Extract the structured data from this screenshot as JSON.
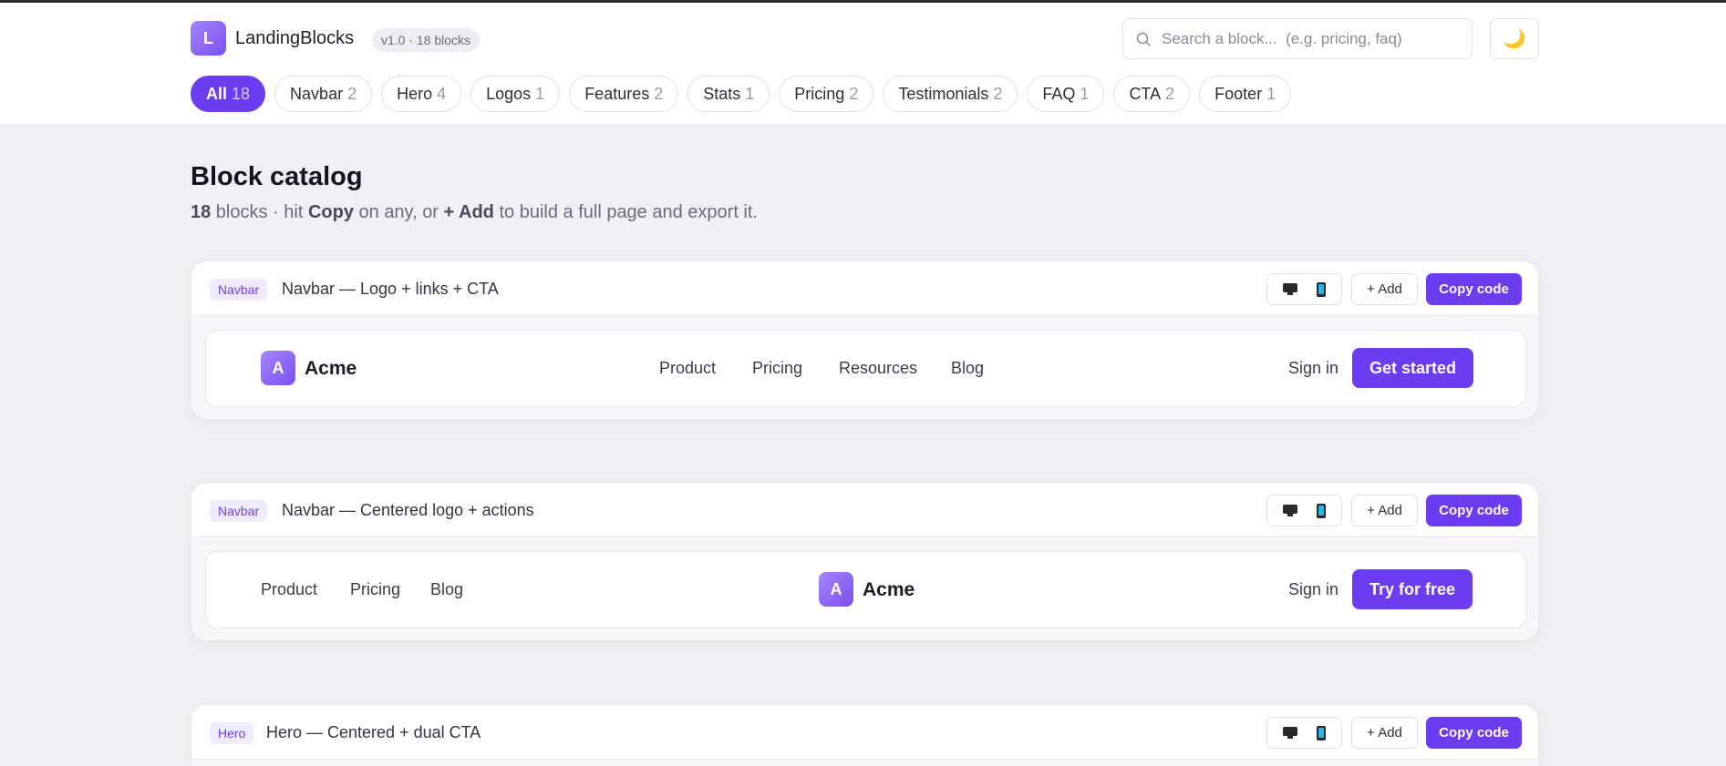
{
  "app": {
    "brand": "LandingBlocks",
    "logo_letter": "L",
    "version": "v1.0 · 18 blocks",
    "theme_icon": "🌙"
  },
  "search": {
    "placeholder": "Search a block...  (e.g. pricing, faq)"
  },
  "filters": [
    {
      "label": "All",
      "count": "18",
      "active": true
    },
    {
      "label": "Navbar",
      "count": "2"
    },
    {
      "label": "Hero",
      "count": "4"
    },
    {
      "label": "Logos",
      "count": "1"
    },
    {
      "label": "Features",
      "count": "2"
    },
    {
      "label": "Stats",
      "count": "1"
    },
    {
      "label": "Pricing",
      "count": "2"
    },
    {
      "label": "Testimonials",
      "count": "2"
    },
    {
      "label": "FAQ",
      "count": "1"
    },
    {
      "label": "CTA",
      "count": "2"
    },
    {
      "label": "Footer",
      "count": "1"
    }
  ],
  "catalog": {
    "title": "Block catalog",
    "sub_count": "18",
    "sub_1": " blocks · hit ",
    "sub_copy": "Copy",
    "sub_2": " on any, or ",
    "sub_add": "+ Add",
    "sub_3": " to build a full page and export it."
  },
  "card_actions": {
    "add": "+ Add",
    "copy": "Copy code"
  },
  "blocks": [
    {
      "tag": "Navbar",
      "title": "Navbar — Logo + links + CTA",
      "preview": {
        "logo_letter": "A",
        "brand": "Acme",
        "links": [
          "Product",
          "Pricing",
          "Resources",
          "Blog"
        ],
        "signin": "Sign in",
        "cta": "Get started"
      }
    },
    {
      "tag": "Navbar",
      "title": "Navbar — Centered logo + actions",
      "preview": {
        "logo_letter": "A",
        "brand": "Acme",
        "links": [
          "Product",
          "Pricing",
          "Blog"
        ],
        "signin": "Sign in",
        "cta": "Try for free"
      }
    },
    {
      "tag": "Hero",
      "title": "Hero — Centered + dual CTA"
    }
  ],
  "colors": {
    "accent": "#6c3df0",
    "background": "#f1f1f5"
  }
}
